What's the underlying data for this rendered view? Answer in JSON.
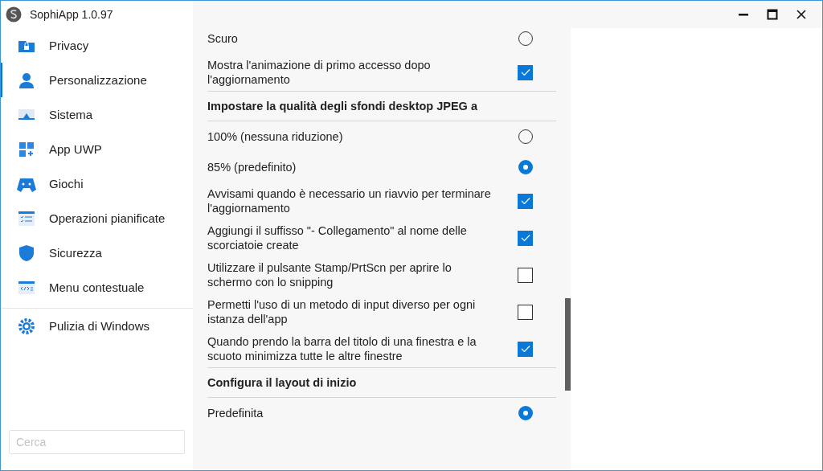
{
  "window": {
    "title": "SophiApp 1.0.97"
  },
  "sidebar": {
    "items": [
      {
        "label": "Privacy",
        "selected": false
      },
      {
        "label": "Personalizzazione",
        "selected": true
      },
      {
        "label": "Sistema",
        "selected": false
      },
      {
        "label": "App UWP",
        "selected": false
      },
      {
        "label": "Giochi",
        "selected": false
      },
      {
        "label": "Operazioni pianificate",
        "selected": false
      },
      {
        "label": "Sicurezza",
        "selected": false
      },
      {
        "label": "Menu contestuale",
        "selected": false
      }
    ],
    "footer_items": [
      {
        "label": "Pulizia di Windows",
        "selected": false
      }
    ],
    "search": {
      "placeholder": "Cerca"
    }
  },
  "settings": [
    {
      "kind": "radio",
      "label": "Scuro",
      "selected": false
    },
    {
      "kind": "checkbox",
      "label": "Mostra l'animazione di primo accesso dopo l'aggiornamento",
      "checked": true
    },
    {
      "kind": "header",
      "label": "Impostare la qualità degli sfondi desktop JPEG a"
    },
    {
      "kind": "radio",
      "label": "100% (nessuna riduzione)",
      "selected": false
    },
    {
      "kind": "radio",
      "label": "85% (predefinito)",
      "selected": true
    },
    {
      "kind": "checkbox",
      "label": "Avvisami quando è necessario un riavvio per terminare l'aggiornamento",
      "checked": true
    },
    {
      "kind": "checkbox",
      "label": "Aggiungi il suffisso \"- Collegamento\" al nome delle scorciatoie create",
      "checked": true
    },
    {
      "kind": "checkbox",
      "label": "Utilizzare il pulsante Stamp/PrtScn per aprire lo schermo con lo snipping",
      "checked": false
    },
    {
      "kind": "checkbox",
      "label": "Permetti l'uso di un metodo di input diverso per ogni istanza dell'app",
      "checked": false
    },
    {
      "kind": "checkbox",
      "label": "Quando prendo la barra del titolo di una finestra e la scuoto minimizza tutte le altre finestre",
      "checked": true
    },
    {
      "kind": "header",
      "label": "Configura il layout di inizio"
    },
    {
      "kind": "radio",
      "label": "Predefinita",
      "selected": true
    }
  ]
}
